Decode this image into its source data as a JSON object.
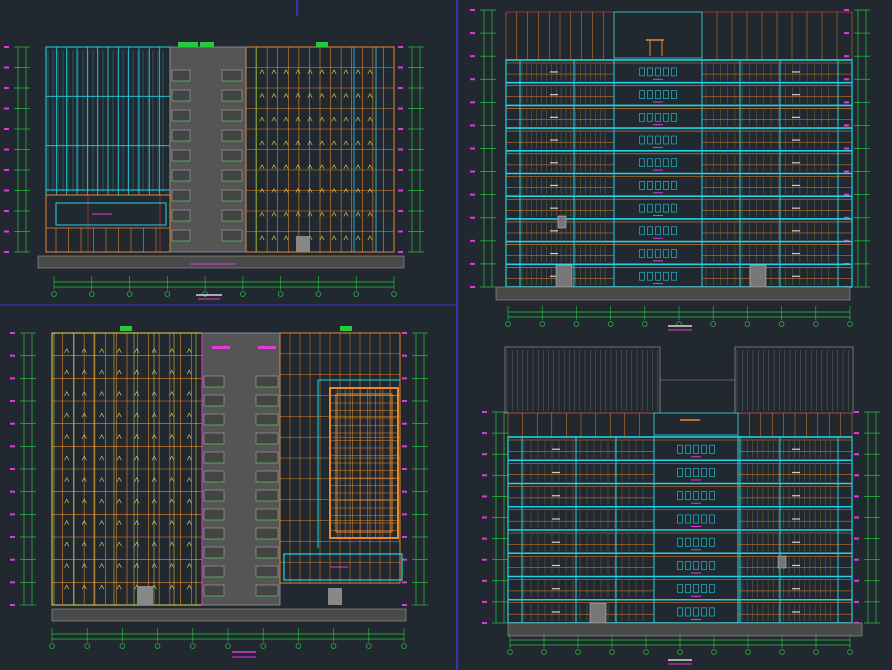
{
  "colors": {
    "background": "#212830",
    "cyan": "#22d3e6",
    "orange": "#e8892c",
    "yellow": "#e9e14a",
    "green": "#27c93f",
    "magenta": "#e03ad8",
    "gray": "#6d6d6d",
    "white": "#d8d8d8",
    "blue": "#3a3ad8",
    "red": "#b83a3a"
  },
  "viewports": [
    {
      "name": "elevation-front",
      "kind": "elevation",
      "floors": 9
    },
    {
      "name": "section-a",
      "kind": "section",
      "floors": 10
    },
    {
      "name": "elevation-rear",
      "kind": "elevation",
      "floors": 12
    },
    {
      "name": "section-b",
      "kind": "section",
      "floors": 9
    }
  ]
}
